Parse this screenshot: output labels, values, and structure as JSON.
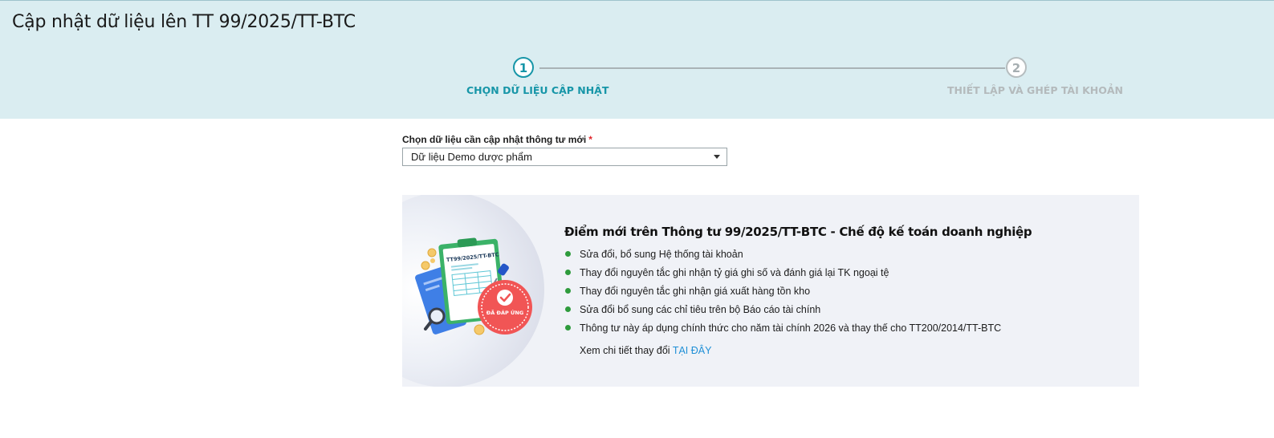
{
  "page": {
    "title": "Cập nhật dữ liệu lên TT 99/2025/TT-BTC"
  },
  "stepper": {
    "steps": [
      {
        "number": "1",
        "label": "CHỌN DỮ LIỆU CẬP NHẬT",
        "state": "active"
      },
      {
        "number": "2",
        "label": "THIẾT LẬP VÀ GHÉP TÀI KHOẢN",
        "state": "inactive"
      }
    ]
  },
  "form": {
    "label": "Chọn dữ liệu cần cập nhật thông tư mới",
    "required_mark": "*",
    "selected_value": "Dữ liệu Demo dược phẩm"
  },
  "info": {
    "title": "Điểm mới trên Thông tư 99/2025/TT-BTC - Chế độ kế toán doanh nghiệp",
    "bullets": [
      "Sửa đổi, bổ sung Hệ thống tài khoản",
      "Thay đổi nguyên tắc ghi nhận tỷ giá ghi số và đánh giá lại TK ngoại tệ",
      "Thay đổi nguyên tắc ghi nhận giá xuất hàng tồn kho",
      "Sửa đổi bổ sung các chỉ tiêu trên bộ Báo cáo tài chính",
      "Thông tư này áp dụng chính thức cho năm tài chính 2026 và thay thế cho TT200/2014/TT-BTC"
    ],
    "more_text": "Xem chi tiết thay đổi",
    "more_link": "TẠI ĐÂY",
    "illustration": {
      "clipboard_text": "TT99/2025/TT-BTC",
      "stamp_text": "ĐÃ ĐÁP ỨNG"
    }
  },
  "colors": {
    "header_bg": "#daedf1",
    "accent": "#1796a8",
    "bullet": "#2e9b3c",
    "link": "#1e8fd6",
    "required": "#e0262c",
    "card_bg": "#f0f2f7"
  }
}
